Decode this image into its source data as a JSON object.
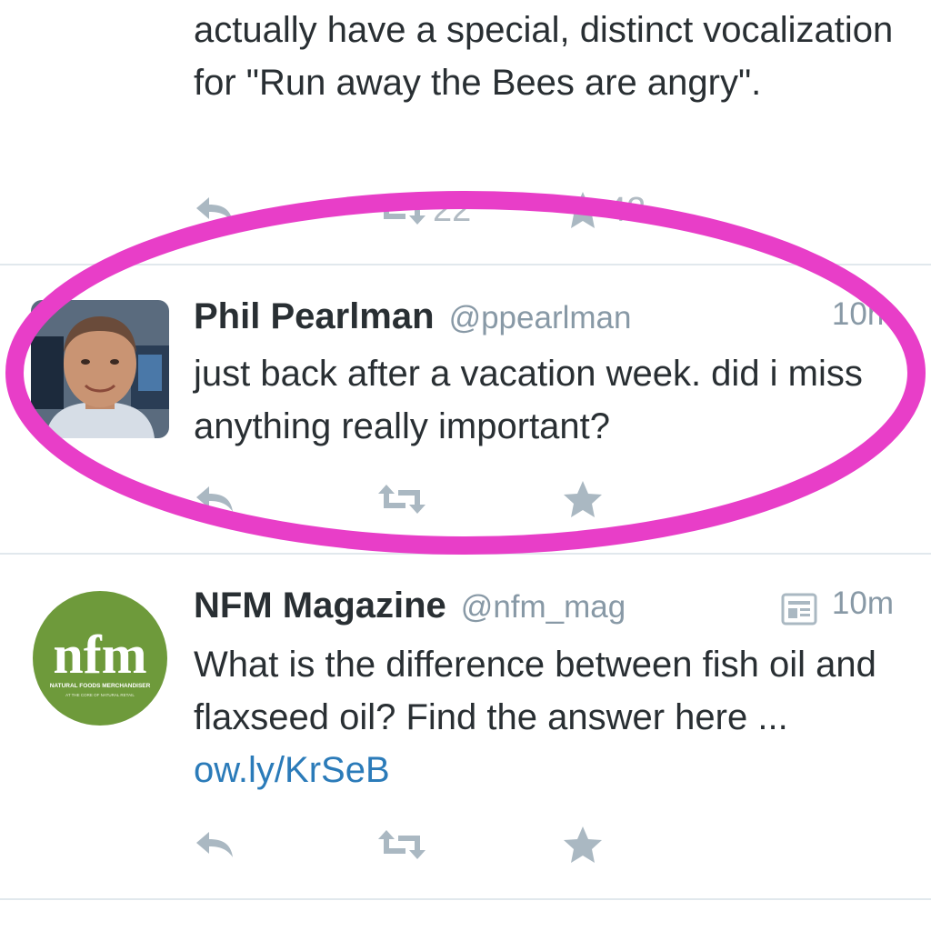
{
  "tweets": [
    {
      "text": "actually have a special, distinct vocalization for \"Run away the Bees are angry\".",
      "retweet_count": "22",
      "favorite_count": "42"
    },
    {
      "name": "Phil Pearlman",
      "handle": "@ppearlman",
      "time": "10m",
      "text": "just back after a vacation week. did i miss anything really important?"
    },
    {
      "name": "NFM Magazine",
      "handle": "@nfm_mag",
      "time": "10m",
      "text": "What is the difference between fish oil and flaxseed oil? Find the answer here ...",
      "link_text": "ow.ly/KrSeB",
      "avatar_logo_text": "nfm",
      "avatar_tagline": "NATURAL FOODS MERCHANDISER",
      "avatar_subtagline": "AT THE CORE OF NATURAL RETAIL"
    }
  ],
  "icons": {
    "reply": "reply-icon",
    "retweet": "retweet-icon",
    "favorite": "star-icon",
    "summary": "summary-card-icon"
  },
  "colors": {
    "highlight": "#e83ec8",
    "action_icon": "#aab8c2",
    "link": "#2b7bb9",
    "nfm_green": "#6e9a3b"
  }
}
